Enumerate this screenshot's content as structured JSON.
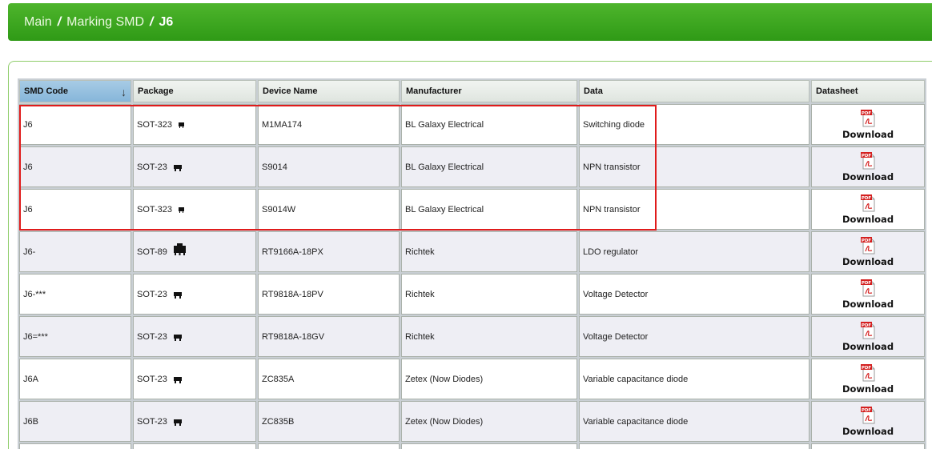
{
  "breadcrumb": {
    "items": [
      "Main",
      "Marking SMD"
    ],
    "separator": "/",
    "current": "J6"
  },
  "table": {
    "columns": [
      "SMD Code",
      "Package",
      "Device Name",
      "Manufacturer",
      "Data",
      "Datasheet"
    ],
    "download_label": "Download",
    "pdf_badge": "PDF",
    "rows": [
      {
        "code": "J6",
        "package": "SOT-323",
        "pkg_icon": "small",
        "device": "M1MA174",
        "manufacturer": "BL Galaxy Electrical",
        "data": "Switching diode"
      },
      {
        "code": "J6",
        "package": "SOT-23",
        "pkg_icon": "mid",
        "device": "S9014",
        "manufacturer": "BL Galaxy Electrical",
        "data": "NPN transistor"
      },
      {
        "code": "J6",
        "package": "SOT-323",
        "pkg_icon": "small",
        "device": "S9014W",
        "manufacturer": "BL Galaxy Electrical",
        "data": "NPN transistor"
      },
      {
        "code": "J6-",
        "package": "SOT-89",
        "pkg_icon": "big",
        "device": "RT9166A-18PX",
        "manufacturer": "Richtek",
        "data": "LDO regulator"
      },
      {
        "code": "J6-***",
        "package": "SOT-23",
        "pkg_icon": "mid",
        "device": "RT9818A-18PV",
        "manufacturer": "Richtek",
        "data": "Voltage Detector"
      },
      {
        "code": "J6=***",
        "package": "SOT-23",
        "pkg_icon": "mid",
        "device": "RT9818A-18GV",
        "manufacturer": "Richtek",
        "data": "Voltage Detector"
      },
      {
        "code": "J6A",
        "package": "SOT-23",
        "pkg_icon": "mid",
        "device": "ZC835A",
        "manufacturer": "Zetex (Now Diodes)",
        "data": "Variable capacitance diode"
      },
      {
        "code": "J6B",
        "package": "SOT-23",
        "pkg_icon": "mid",
        "device": "ZC835B",
        "manufacturer": "Zetex (Now Diodes)",
        "data": "Variable capacitance diode"
      }
    ]
  },
  "colors": {
    "header_green": "#3aa31e",
    "sorted_header": "#93bfe0",
    "highlight": "#e01b1b",
    "pdf_red": "#d42020"
  }
}
